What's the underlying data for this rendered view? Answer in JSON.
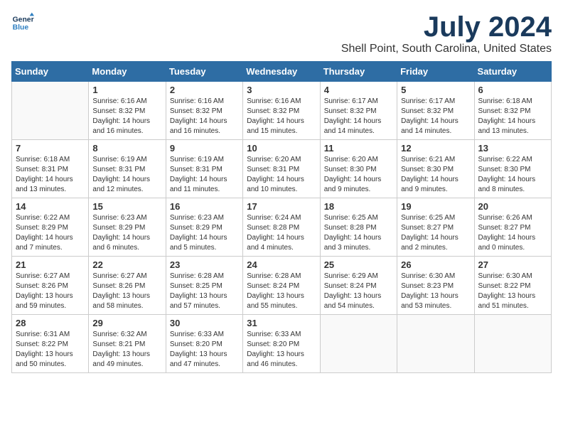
{
  "logo": {
    "line1": "General",
    "line2": "Blue"
  },
  "title": "July 2024",
  "location": "Shell Point, South Carolina, United States",
  "weekdays": [
    "Sunday",
    "Monday",
    "Tuesday",
    "Wednesday",
    "Thursday",
    "Friday",
    "Saturday"
  ],
  "weeks": [
    [
      {
        "day": "",
        "info": ""
      },
      {
        "day": "1",
        "info": "Sunrise: 6:16 AM\nSunset: 8:32 PM\nDaylight: 14 hours\nand 16 minutes."
      },
      {
        "day": "2",
        "info": "Sunrise: 6:16 AM\nSunset: 8:32 PM\nDaylight: 14 hours\nand 16 minutes."
      },
      {
        "day": "3",
        "info": "Sunrise: 6:16 AM\nSunset: 8:32 PM\nDaylight: 14 hours\nand 15 minutes."
      },
      {
        "day": "4",
        "info": "Sunrise: 6:17 AM\nSunset: 8:32 PM\nDaylight: 14 hours\nand 14 minutes."
      },
      {
        "day": "5",
        "info": "Sunrise: 6:17 AM\nSunset: 8:32 PM\nDaylight: 14 hours\nand 14 minutes."
      },
      {
        "day": "6",
        "info": "Sunrise: 6:18 AM\nSunset: 8:32 PM\nDaylight: 14 hours\nand 13 minutes."
      }
    ],
    [
      {
        "day": "7",
        "info": "Sunrise: 6:18 AM\nSunset: 8:31 PM\nDaylight: 14 hours\nand 13 minutes."
      },
      {
        "day": "8",
        "info": "Sunrise: 6:19 AM\nSunset: 8:31 PM\nDaylight: 14 hours\nand 12 minutes."
      },
      {
        "day": "9",
        "info": "Sunrise: 6:19 AM\nSunset: 8:31 PM\nDaylight: 14 hours\nand 11 minutes."
      },
      {
        "day": "10",
        "info": "Sunrise: 6:20 AM\nSunset: 8:31 PM\nDaylight: 14 hours\nand 10 minutes."
      },
      {
        "day": "11",
        "info": "Sunrise: 6:20 AM\nSunset: 8:30 PM\nDaylight: 14 hours\nand 9 minutes."
      },
      {
        "day": "12",
        "info": "Sunrise: 6:21 AM\nSunset: 8:30 PM\nDaylight: 14 hours\nand 9 minutes."
      },
      {
        "day": "13",
        "info": "Sunrise: 6:22 AM\nSunset: 8:30 PM\nDaylight: 14 hours\nand 8 minutes."
      }
    ],
    [
      {
        "day": "14",
        "info": "Sunrise: 6:22 AM\nSunset: 8:29 PM\nDaylight: 14 hours\nand 7 minutes."
      },
      {
        "day": "15",
        "info": "Sunrise: 6:23 AM\nSunset: 8:29 PM\nDaylight: 14 hours\nand 6 minutes."
      },
      {
        "day": "16",
        "info": "Sunrise: 6:23 AM\nSunset: 8:29 PM\nDaylight: 14 hours\nand 5 minutes."
      },
      {
        "day": "17",
        "info": "Sunrise: 6:24 AM\nSunset: 8:28 PM\nDaylight: 14 hours\nand 4 minutes."
      },
      {
        "day": "18",
        "info": "Sunrise: 6:25 AM\nSunset: 8:28 PM\nDaylight: 14 hours\nand 3 minutes."
      },
      {
        "day": "19",
        "info": "Sunrise: 6:25 AM\nSunset: 8:27 PM\nDaylight: 14 hours\nand 2 minutes."
      },
      {
        "day": "20",
        "info": "Sunrise: 6:26 AM\nSunset: 8:27 PM\nDaylight: 14 hours\nand 0 minutes."
      }
    ],
    [
      {
        "day": "21",
        "info": "Sunrise: 6:27 AM\nSunset: 8:26 PM\nDaylight: 13 hours\nand 59 minutes."
      },
      {
        "day": "22",
        "info": "Sunrise: 6:27 AM\nSunset: 8:26 PM\nDaylight: 13 hours\nand 58 minutes."
      },
      {
        "day": "23",
        "info": "Sunrise: 6:28 AM\nSunset: 8:25 PM\nDaylight: 13 hours\nand 57 minutes."
      },
      {
        "day": "24",
        "info": "Sunrise: 6:28 AM\nSunset: 8:24 PM\nDaylight: 13 hours\nand 55 minutes."
      },
      {
        "day": "25",
        "info": "Sunrise: 6:29 AM\nSunset: 8:24 PM\nDaylight: 13 hours\nand 54 minutes."
      },
      {
        "day": "26",
        "info": "Sunrise: 6:30 AM\nSunset: 8:23 PM\nDaylight: 13 hours\nand 53 minutes."
      },
      {
        "day": "27",
        "info": "Sunrise: 6:30 AM\nSunset: 8:22 PM\nDaylight: 13 hours\nand 51 minutes."
      }
    ],
    [
      {
        "day": "28",
        "info": "Sunrise: 6:31 AM\nSunset: 8:22 PM\nDaylight: 13 hours\nand 50 minutes."
      },
      {
        "day": "29",
        "info": "Sunrise: 6:32 AM\nSunset: 8:21 PM\nDaylight: 13 hours\nand 49 minutes."
      },
      {
        "day": "30",
        "info": "Sunrise: 6:33 AM\nSunset: 8:20 PM\nDaylight: 13 hours\nand 47 minutes."
      },
      {
        "day": "31",
        "info": "Sunrise: 6:33 AM\nSunset: 8:20 PM\nDaylight: 13 hours\nand 46 minutes."
      },
      {
        "day": "",
        "info": ""
      },
      {
        "day": "",
        "info": ""
      },
      {
        "day": "",
        "info": ""
      }
    ]
  ]
}
